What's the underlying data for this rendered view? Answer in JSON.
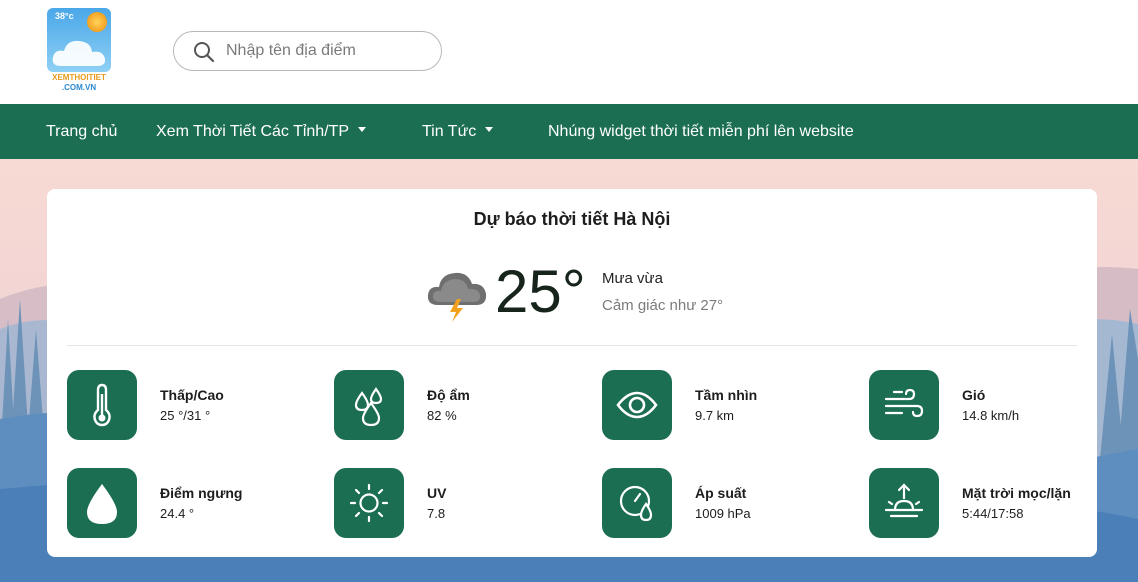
{
  "header": {
    "logo": {
      "temp": "38°c",
      "line1": "XEMTHOITIET",
      "line2": ".COM.VN"
    },
    "search": {
      "placeholder": "Nhập tên địa điểm"
    }
  },
  "nav": {
    "items": [
      {
        "label": "Trang chủ",
        "dropdown": false
      },
      {
        "label": "Xem Thời Tiết Các Tỉnh/TP",
        "dropdown": true
      },
      {
        "label": "Tin Tức",
        "dropdown": true
      },
      {
        "label": "Nhúng widget thời tiết miễn phí lên website",
        "dropdown": false
      }
    ],
    "bg_color": "#1b6e52"
  },
  "forecast": {
    "title": "Dự báo thời tiết Hà Nội",
    "temperature": "25°",
    "condition": "Mưa vừa",
    "feels_like": "Cảm giác như 27°",
    "icon": "thunderstorm-cloud-icon",
    "stats": [
      {
        "label": "Thấp/Cao",
        "value": "25 °/31 °",
        "icon": "thermometer-icon"
      },
      {
        "label": "Độ ẩm",
        "value": "82 %",
        "icon": "humidity-icon"
      },
      {
        "label": "Tầm nhìn",
        "value": "9.7 km",
        "icon": "eye-icon"
      },
      {
        "label": "Gió",
        "value": "14.8 km/h",
        "icon": "wind-icon"
      },
      {
        "label": "Điểm ngưng",
        "value": "24.4 °",
        "icon": "dew-drop-icon"
      },
      {
        "label": "UV",
        "value": "7.8",
        "icon": "sun-icon"
      },
      {
        "label": "Áp suất",
        "value": "1009 hPa",
        "icon": "pressure-gauge-icon"
      },
      {
        "label": "Mặt trời mọc/lặn",
        "value": "5:44/17:58",
        "icon": "sunrise-icon"
      }
    ]
  },
  "colors": {
    "accent": "#1b6e52",
    "card": "#ffffff"
  }
}
